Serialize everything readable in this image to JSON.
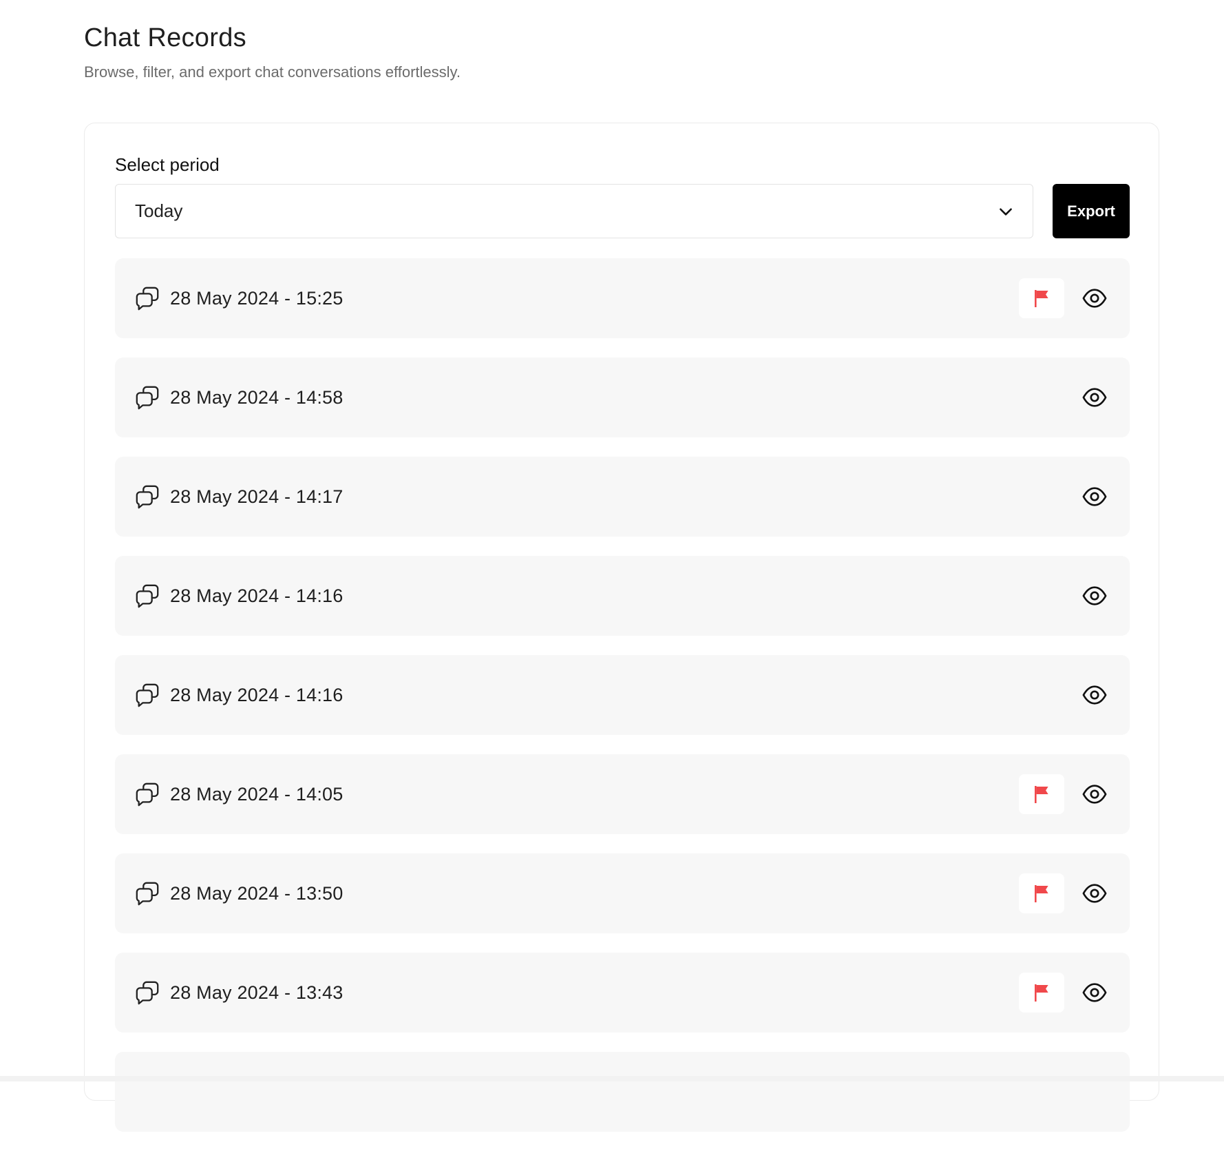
{
  "header": {
    "title": "Chat Records",
    "subtitle": "Browse, filter, and export chat conversations effortlessly."
  },
  "filter": {
    "label": "Select period",
    "selected": "Today",
    "export_label": "Export"
  },
  "colors": {
    "flag": "#f0484b",
    "export_bg": "#000000",
    "row_bg": "#f7f7f7"
  },
  "icons": {
    "row": "chat-bubbles-icon",
    "flag": "flag-icon",
    "view": "eye-icon",
    "dropdown": "chevron-down-icon"
  },
  "records": [
    {
      "timestamp": "28 May 2024 - 15:25",
      "flagged": true
    },
    {
      "timestamp": "28 May 2024 - 14:58",
      "flagged": false
    },
    {
      "timestamp": "28 May 2024 - 14:17",
      "flagged": false
    },
    {
      "timestamp": "28 May 2024 - 14:16",
      "flagged": false
    },
    {
      "timestamp": "28 May 2024 - 14:16",
      "flagged": false
    },
    {
      "timestamp": "28 May 2024 - 14:05",
      "flagged": true
    },
    {
      "timestamp": "28 May 2024 - 13:50",
      "flagged": true
    },
    {
      "timestamp": "28 May 2024 - 13:43",
      "flagged": true
    },
    {
      "timestamp": "",
      "flagged": false
    }
  ]
}
